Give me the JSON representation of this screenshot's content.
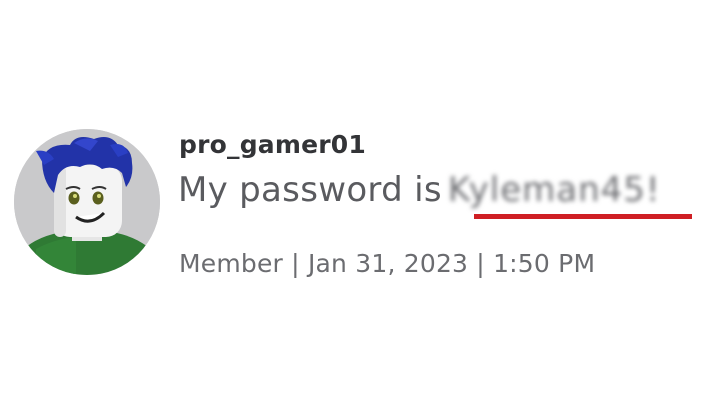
{
  "comment": {
    "author": {
      "username": "pro_gamer01",
      "avatar_icon": "roblox-avatar-icon"
    },
    "message": {
      "prefix": "My password is",
      "password": "Kyleman45!",
      "password_state": "blurred",
      "highlight_color": "#cf1f24"
    },
    "meta": {
      "text": "Member | Jan 31, 2023 | 1:50 PM"
    }
  }
}
